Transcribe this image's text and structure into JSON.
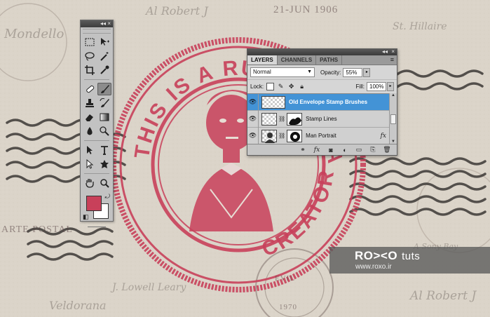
{
  "canvas": {
    "stamp_color": "#c8405a",
    "stamp_ring_text": "THIS IS A RUBBER STAMP",
    "stamp_ring_text_right": "CREATOR",
    "postmark_date": "21-JUN 1906",
    "postmark_year": "1970",
    "postmark_evil": "EVIL",
    "postal_text": "ARTE POSTAL",
    "script_lines": [
      "Mondello",
      "Al Robert J",
      "Veldorana",
      "Al Robert J",
      "J. Lowell Leary",
      "A Sony Bay",
      "St. Hillaire"
    ]
  },
  "tools_panel": {
    "title_controls": "◂◂",
    "close_control": "×",
    "tools": [
      [
        "marquee-tool-icon",
        "move-tool-icon"
      ],
      [
        "lasso-tool-icon",
        "magic-wand-tool-icon"
      ],
      [
        "crop-tool-icon",
        "eyedropper-tool-icon"
      ],
      [
        "healing-brush-tool-icon",
        "brush-tool-icon"
      ],
      [
        "clone-stamp-tool-icon",
        "history-brush-tool-icon"
      ],
      [
        "eraser-tool-icon",
        "gradient-tool-icon"
      ],
      [
        "blur-tool-icon",
        "dodge-tool-icon"
      ],
      [
        "path-selection-tool-icon",
        "type-tool-icon"
      ],
      [
        "direct-selection-tool-icon",
        "custom-shape-tool-icon"
      ],
      [
        "hand-tool-icon",
        "zoom-tool-icon"
      ]
    ],
    "active_tool": "brush-tool-icon",
    "foreground_color": "#c8405a",
    "background_color": "#ffffff"
  },
  "layers_panel": {
    "title_controls": "◂◂",
    "close_control": "×",
    "tabs": [
      {
        "label": "LAYERS",
        "active": true
      },
      {
        "label": "CHANNELS",
        "active": false
      },
      {
        "label": "PATHS",
        "active": false
      }
    ],
    "blend_mode": "Normal",
    "opacity_label": "Opacity:",
    "opacity_value": "55%",
    "lock_label": "Lock:",
    "fill_label": "Fill:",
    "fill_value": "100%",
    "layers": [
      {
        "name": "Old Envelope Stamp Brushes",
        "selected": true,
        "has_mask": false,
        "has_fx": false
      },
      {
        "name": "Stamp Lines",
        "selected": false,
        "has_mask": true,
        "has_fx": false
      },
      {
        "name": "Man Portrait",
        "selected": false,
        "has_mask": true,
        "has_fx": true
      }
    ],
    "fx_label": "fx"
  },
  "watermark": {
    "brand": "RO><O",
    "brand_suffix": "tuts",
    "url": "www.roxo.ir"
  }
}
